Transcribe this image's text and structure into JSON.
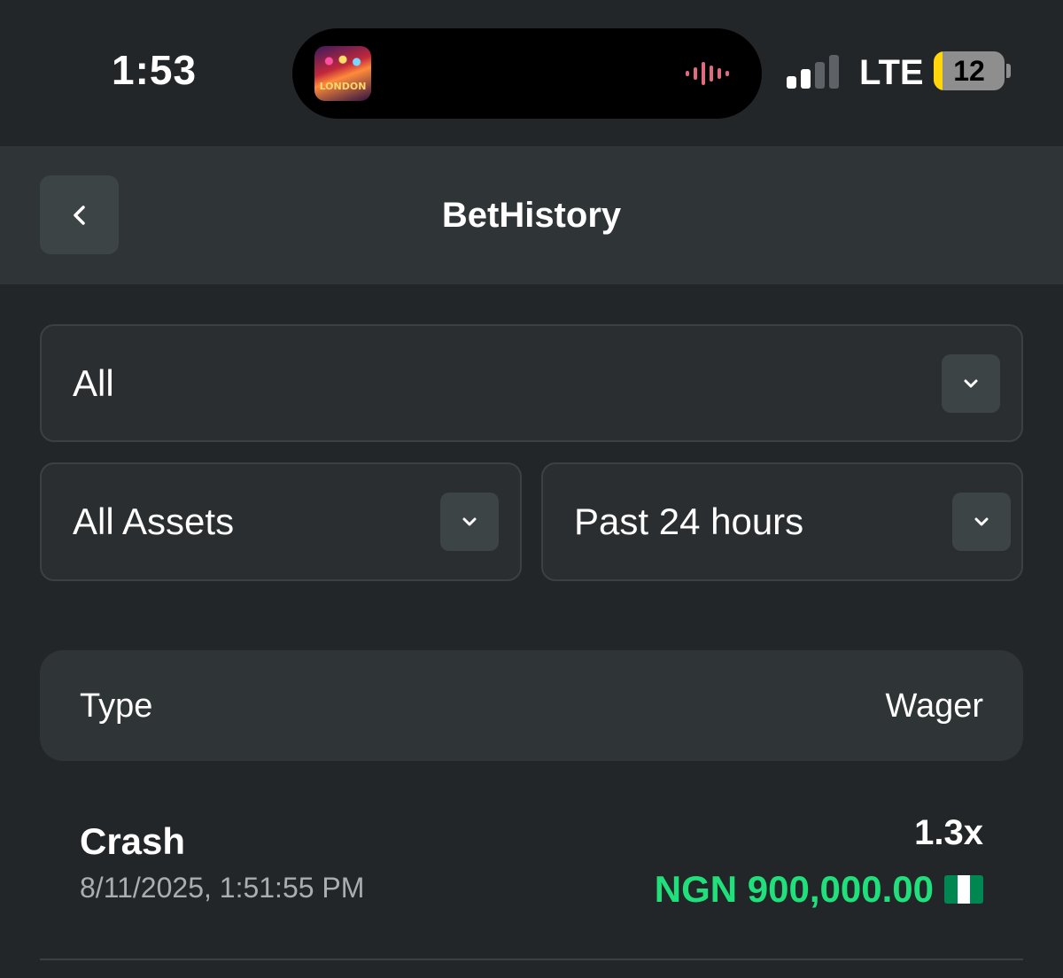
{
  "status_bar": {
    "time": "1:53",
    "now_playing_art_text": "LONDON",
    "network": "LTE",
    "battery_percent": "12",
    "battery_level": 0.12,
    "signal_bars_active": 2,
    "waveform_color": "#e06b7e"
  },
  "header": {
    "title": "BetHistory",
    "back_icon": "chevron-left-icon"
  },
  "filters": {
    "type": {
      "value": "All",
      "icon": "chevron-down-icon"
    },
    "assets": {
      "value": "All Assets",
      "icon": "chevron-down-icon"
    },
    "time_range": {
      "value": "Past 24 hours",
      "icon": "chevron-down-icon"
    }
  },
  "table": {
    "columns": {
      "type": "Type",
      "wager": "Wager"
    },
    "rows": [
      {
        "game": "Crash",
        "datetime": "8/11/2025, 1:51:55 PM",
        "multiplier": "1.3x",
        "amount": "NGN 900,000.00",
        "currency_flag": "nigeria-flag-icon"
      }
    ]
  },
  "colors": {
    "background": "#232628",
    "header_bg": "#2f3436",
    "amount_green": "#1fe07a",
    "flag_green": "#008751"
  }
}
